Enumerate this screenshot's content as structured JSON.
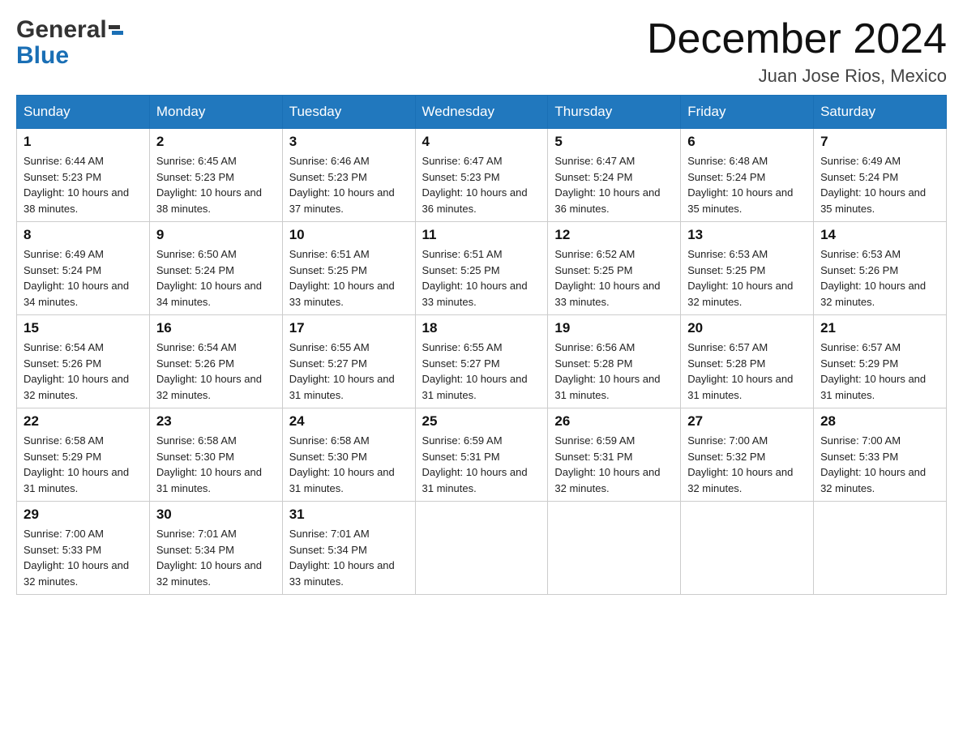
{
  "header": {
    "logo_text1": "General",
    "logo_text2": "Blue",
    "month_title": "December 2024",
    "location": "Juan Jose Rios, Mexico"
  },
  "weekdays": [
    "Sunday",
    "Monday",
    "Tuesday",
    "Wednesday",
    "Thursday",
    "Friday",
    "Saturday"
  ],
  "weeks": [
    [
      {
        "day": "1",
        "sunrise": "6:44 AM",
        "sunset": "5:23 PM",
        "daylight": "10 hours and 38 minutes."
      },
      {
        "day": "2",
        "sunrise": "6:45 AM",
        "sunset": "5:23 PM",
        "daylight": "10 hours and 38 minutes."
      },
      {
        "day": "3",
        "sunrise": "6:46 AM",
        "sunset": "5:23 PM",
        "daylight": "10 hours and 37 minutes."
      },
      {
        "day": "4",
        "sunrise": "6:47 AM",
        "sunset": "5:23 PM",
        "daylight": "10 hours and 36 minutes."
      },
      {
        "day": "5",
        "sunrise": "6:47 AM",
        "sunset": "5:24 PM",
        "daylight": "10 hours and 36 minutes."
      },
      {
        "day": "6",
        "sunrise": "6:48 AM",
        "sunset": "5:24 PM",
        "daylight": "10 hours and 35 minutes."
      },
      {
        "day": "7",
        "sunrise": "6:49 AM",
        "sunset": "5:24 PM",
        "daylight": "10 hours and 35 minutes."
      }
    ],
    [
      {
        "day": "8",
        "sunrise": "6:49 AM",
        "sunset": "5:24 PM",
        "daylight": "10 hours and 34 minutes."
      },
      {
        "day": "9",
        "sunrise": "6:50 AM",
        "sunset": "5:24 PM",
        "daylight": "10 hours and 34 minutes."
      },
      {
        "day": "10",
        "sunrise": "6:51 AM",
        "sunset": "5:25 PM",
        "daylight": "10 hours and 33 minutes."
      },
      {
        "day": "11",
        "sunrise": "6:51 AM",
        "sunset": "5:25 PM",
        "daylight": "10 hours and 33 minutes."
      },
      {
        "day": "12",
        "sunrise": "6:52 AM",
        "sunset": "5:25 PM",
        "daylight": "10 hours and 33 minutes."
      },
      {
        "day": "13",
        "sunrise": "6:53 AM",
        "sunset": "5:25 PM",
        "daylight": "10 hours and 32 minutes."
      },
      {
        "day": "14",
        "sunrise": "6:53 AM",
        "sunset": "5:26 PM",
        "daylight": "10 hours and 32 minutes."
      }
    ],
    [
      {
        "day": "15",
        "sunrise": "6:54 AM",
        "sunset": "5:26 PM",
        "daylight": "10 hours and 32 minutes."
      },
      {
        "day": "16",
        "sunrise": "6:54 AM",
        "sunset": "5:26 PM",
        "daylight": "10 hours and 32 minutes."
      },
      {
        "day": "17",
        "sunrise": "6:55 AM",
        "sunset": "5:27 PM",
        "daylight": "10 hours and 31 minutes."
      },
      {
        "day": "18",
        "sunrise": "6:55 AM",
        "sunset": "5:27 PM",
        "daylight": "10 hours and 31 minutes."
      },
      {
        "day": "19",
        "sunrise": "6:56 AM",
        "sunset": "5:28 PM",
        "daylight": "10 hours and 31 minutes."
      },
      {
        "day": "20",
        "sunrise": "6:57 AM",
        "sunset": "5:28 PM",
        "daylight": "10 hours and 31 minutes."
      },
      {
        "day": "21",
        "sunrise": "6:57 AM",
        "sunset": "5:29 PM",
        "daylight": "10 hours and 31 minutes."
      }
    ],
    [
      {
        "day": "22",
        "sunrise": "6:58 AM",
        "sunset": "5:29 PM",
        "daylight": "10 hours and 31 minutes."
      },
      {
        "day": "23",
        "sunrise": "6:58 AM",
        "sunset": "5:30 PM",
        "daylight": "10 hours and 31 minutes."
      },
      {
        "day": "24",
        "sunrise": "6:58 AM",
        "sunset": "5:30 PM",
        "daylight": "10 hours and 31 minutes."
      },
      {
        "day": "25",
        "sunrise": "6:59 AM",
        "sunset": "5:31 PM",
        "daylight": "10 hours and 31 minutes."
      },
      {
        "day": "26",
        "sunrise": "6:59 AM",
        "sunset": "5:31 PM",
        "daylight": "10 hours and 32 minutes."
      },
      {
        "day": "27",
        "sunrise": "7:00 AM",
        "sunset": "5:32 PM",
        "daylight": "10 hours and 32 minutes."
      },
      {
        "day": "28",
        "sunrise": "7:00 AM",
        "sunset": "5:33 PM",
        "daylight": "10 hours and 32 minutes."
      }
    ],
    [
      {
        "day": "29",
        "sunrise": "7:00 AM",
        "sunset": "5:33 PM",
        "daylight": "10 hours and 32 minutes."
      },
      {
        "day": "30",
        "sunrise": "7:01 AM",
        "sunset": "5:34 PM",
        "daylight": "10 hours and 32 minutes."
      },
      {
        "day": "31",
        "sunrise": "7:01 AM",
        "sunset": "5:34 PM",
        "daylight": "10 hours and 33 minutes."
      },
      null,
      null,
      null,
      null
    ]
  ]
}
